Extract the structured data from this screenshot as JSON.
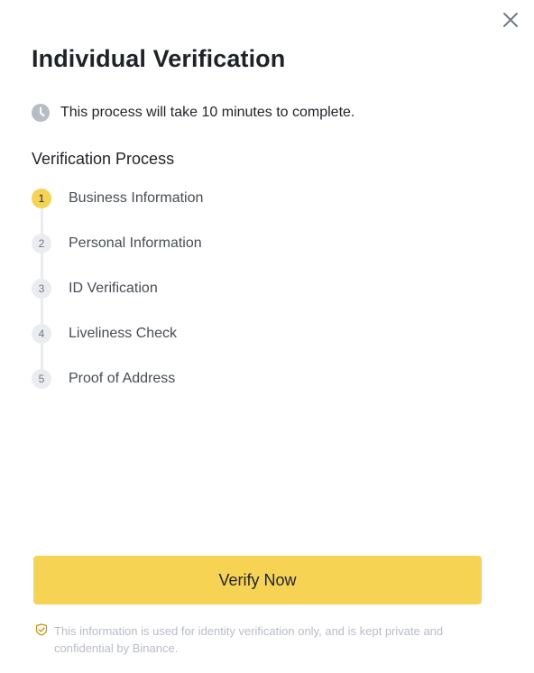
{
  "dialog": {
    "title": "Individual Verification",
    "close_icon": "close-icon"
  },
  "notice": {
    "icon": "clock-icon",
    "text": "This process will take 10 minutes to complete."
  },
  "process": {
    "title": "Verification Process",
    "steps": [
      {
        "number": "1",
        "label": "Business Information",
        "active": true
      },
      {
        "number": "2",
        "label": "Personal Information",
        "active": false
      },
      {
        "number": "3",
        "label": "ID Verification",
        "active": false
      },
      {
        "number": "4",
        "label": "Liveliness Check",
        "active": false
      },
      {
        "number": "5",
        "label": "Proof of Address",
        "active": false
      }
    ]
  },
  "actions": {
    "verify_label": "Verify Now"
  },
  "privacy": {
    "icon": "shield-check-icon",
    "text": "This information is used for identity verification only, and is kept private and confidential by Binance."
  },
  "colors": {
    "accent": "#f6d352",
    "text_primary": "#1e2329",
    "text_secondary": "#474d57",
    "muted": "#b7bdc6",
    "step_inactive_bg": "#eaecef"
  }
}
